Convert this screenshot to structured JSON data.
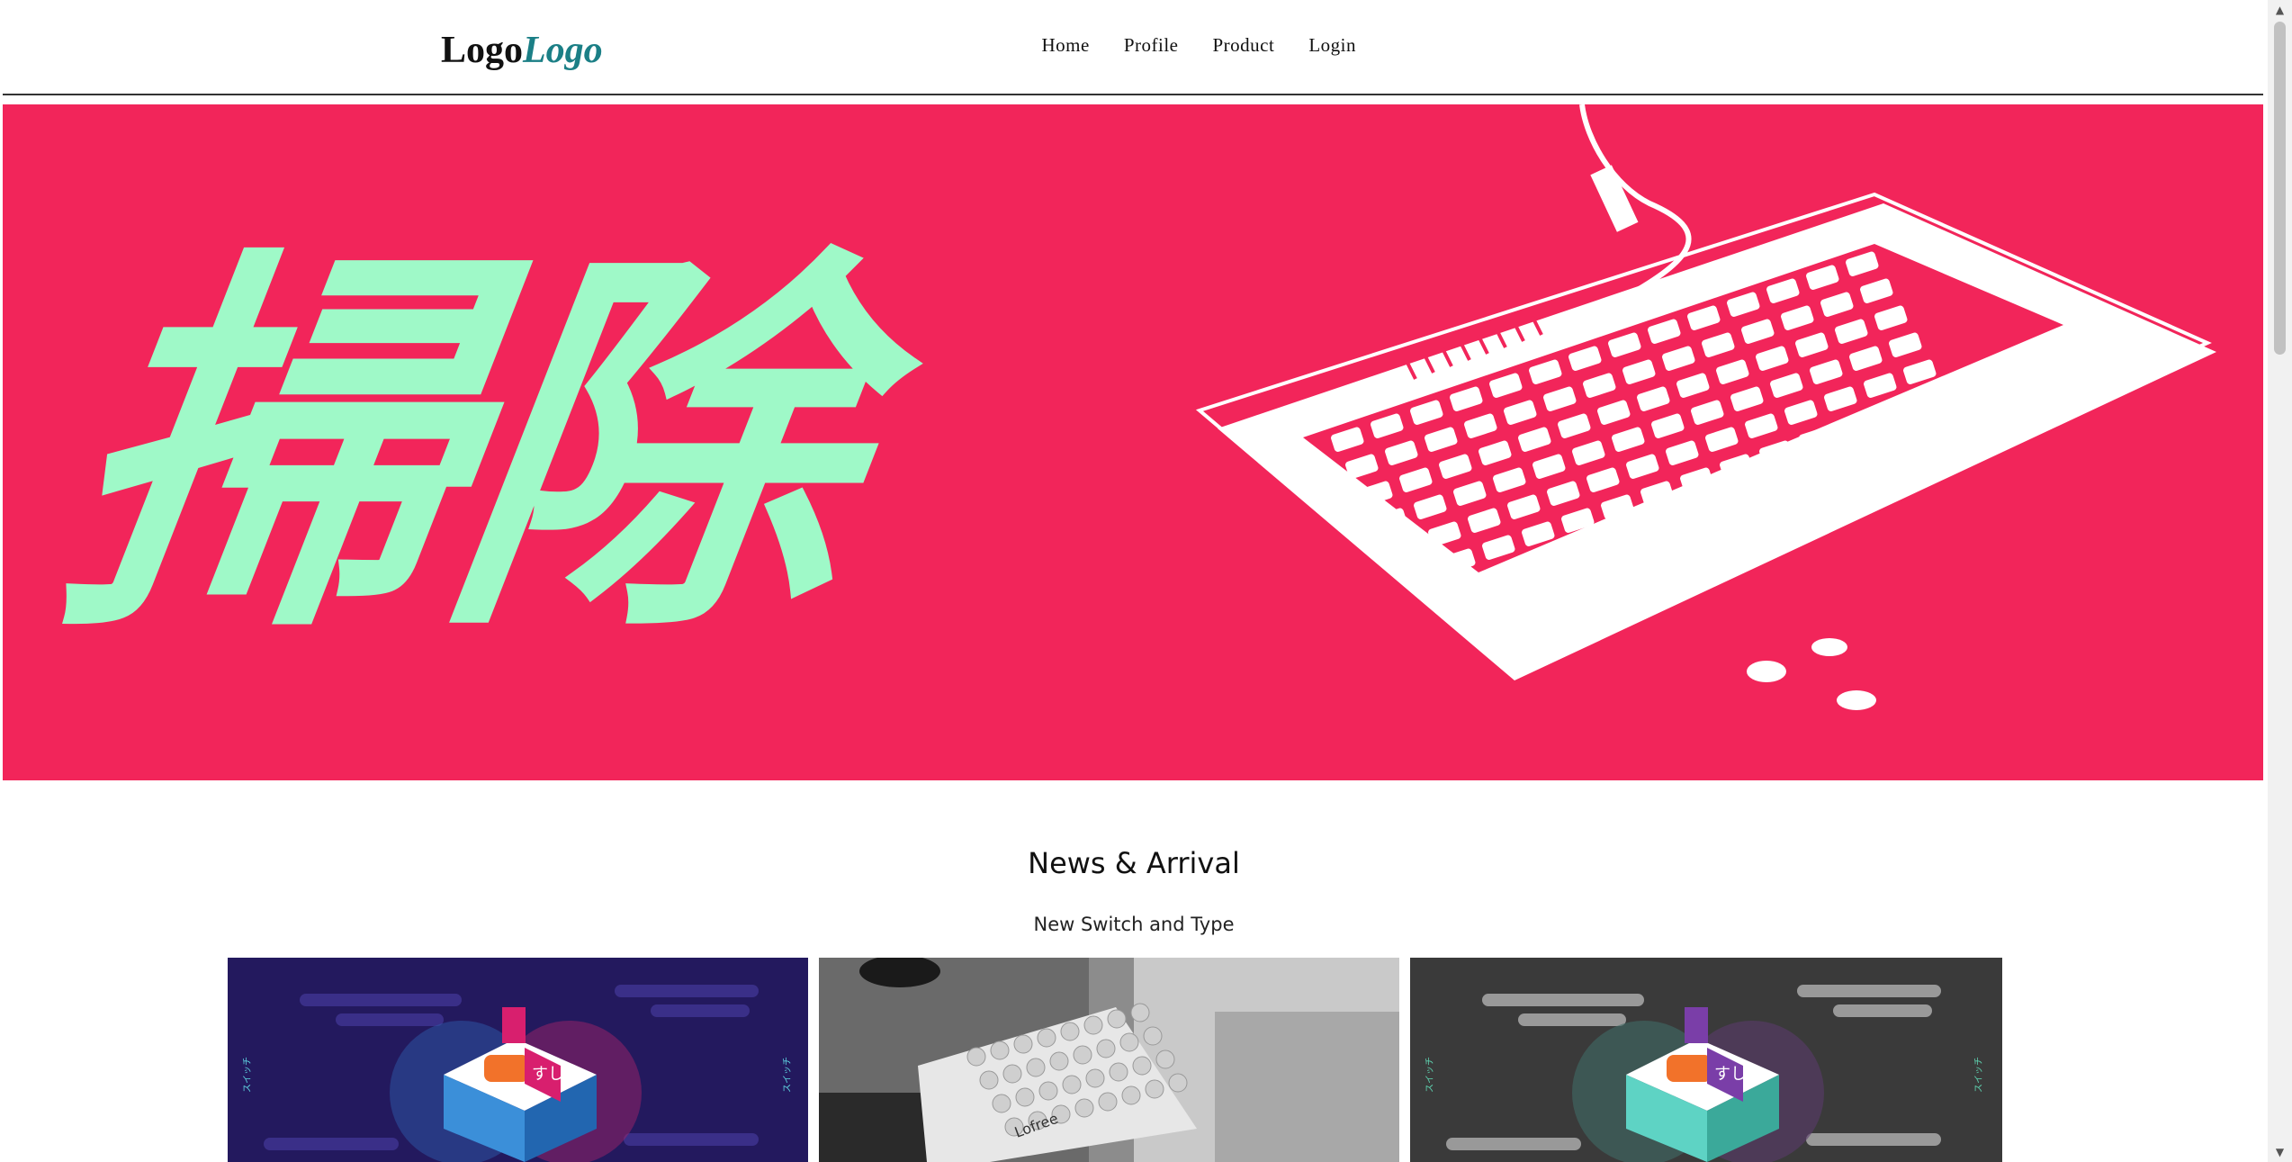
{
  "header": {
    "logo_part1": "Logo",
    "logo_part2": "Logo",
    "nav": [
      "Home",
      "Profile",
      "Product",
      "Login"
    ]
  },
  "hero": {
    "headline": "掃除",
    "colors": {
      "background": "#f2255a",
      "headline": "#9ff9c8",
      "keyboard": "#ffffff"
    }
  },
  "news": {
    "title": "News & Arrival",
    "subtitle": "New Switch and Type"
  },
  "cards": [
    {
      "name": "sushi-switch-purple",
      "text": "すし",
      "side_text": "スイッチ"
    },
    {
      "name": "keyboard-photo",
      "text": "Lofree"
    },
    {
      "name": "sushi-switch-grey",
      "text": "すし",
      "side_text": "スイッチ"
    }
  ]
}
